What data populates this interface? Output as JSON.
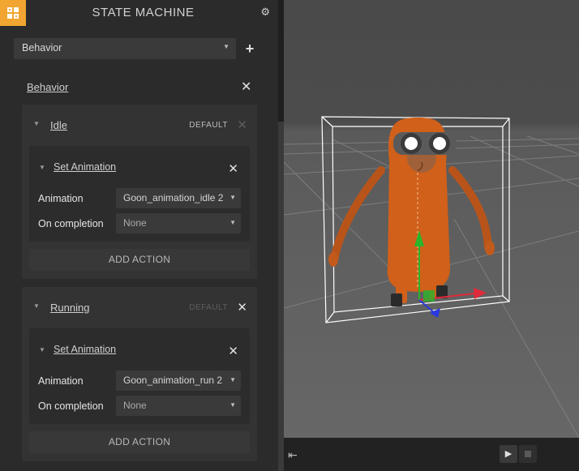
{
  "panel": {
    "title": "STATE MACHINE",
    "behavior_select": "Behavior",
    "behavior_title": "Behavior"
  },
  "states": [
    {
      "name": "Idle",
      "default_label": "DEFAULT",
      "action": {
        "name": "Set Animation",
        "animation_label": "Animation",
        "animation_value": "Goon_animation_idle 2",
        "completion_label": "On completion",
        "completion_value": "None"
      },
      "add_action": "ADD ACTION"
    },
    {
      "name": "Running",
      "default_label": "DEFAULT",
      "action": {
        "name": "Set Animation",
        "animation_label": "Animation",
        "animation_value": "Goon_animation_run 2",
        "completion_label": "On completion",
        "completion_value": "None"
      },
      "add_action": "ADD ACTION"
    }
  ],
  "colors": {
    "accent": "#f2a531",
    "panel_bg": "#2b2b2b",
    "character": "#d0601a"
  },
  "icons": [
    "logo-icon",
    "gear-icon",
    "plus-icon",
    "close-icon",
    "triangle-down-icon",
    "dropdown-caret-icon",
    "exit-icon",
    "play-icon",
    "stop-icon"
  ]
}
